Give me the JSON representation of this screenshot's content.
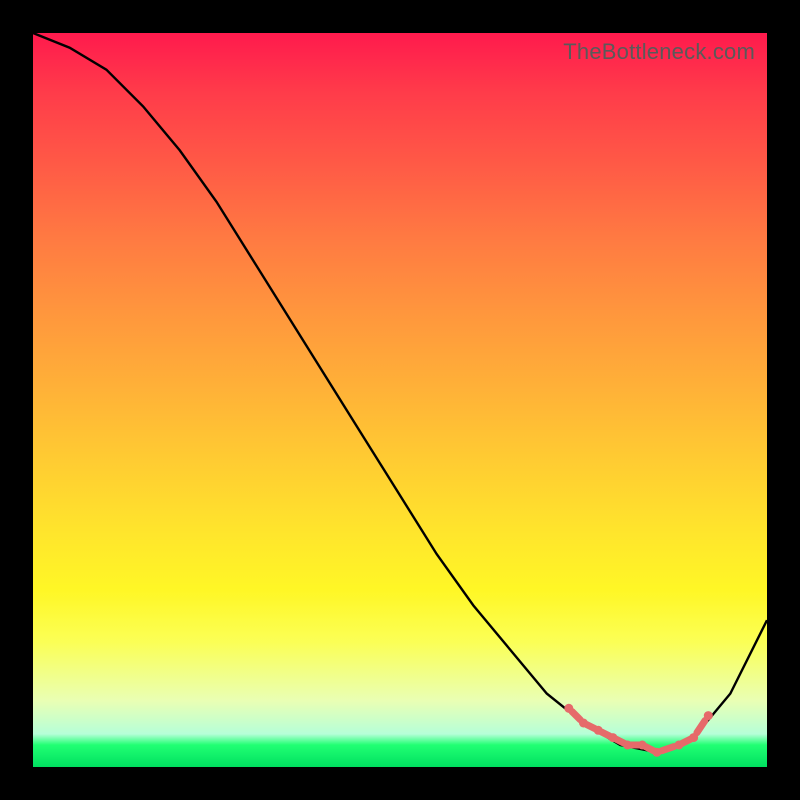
{
  "watermark": "TheBottleneck.com",
  "chart_data": {
    "type": "line",
    "title": "",
    "xlabel": "",
    "ylabel": "",
    "xlim": [
      0,
      100
    ],
    "ylim": [
      0,
      100
    ],
    "grid": false,
    "series": [
      {
        "name": "curve",
        "x": [
          0,
          5,
          10,
          15,
          20,
          25,
          30,
          35,
          40,
          45,
          50,
          55,
          60,
          65,
          70,
          75,
          80,
          85,
          90,
          95,
          100
        ],
        "values": [
          100,
          98,
          95,
          90,
          84,
          77,
          69,
          61,
          53,
          45,
          37,
          29,
          22,
          16,
          10,
          6,
          3,
          2,
          4,
          10,
          20
        ]
      }
    ],
    "highlighted_points": {
      "x": [
        73,
        75,
        77,
        79,
        81,
        83,
        85,
        88,
        90,
        92
      ],
      "y": [
        8,
        6,
        5,
        4,
        3,
        3,
        2,
        3,
        4,
        7
      ]
    }
  }
}
